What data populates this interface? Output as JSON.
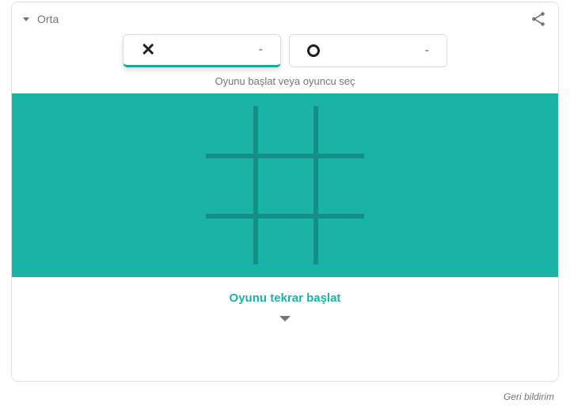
{
  "header": {
    "difficulty_label": "Orta"
  },
  "players": {
    "x": {
      "mark": "✕",
      "score": "-"
    },
    "o": {
      "mark": "O",
      "score": "-"
    }
  },
  "subtext": "Oyunu başlat veya oyuncu seç",
  "restart_label": "Oyunu tekrar başlat",
  "feedback_label": "Geri bildirim",
  "colors": {
    "board_bg": "#1ab3a6",
    "grid_line": "#148f85",
    "accent": "#1ab3a6"
  }
}
